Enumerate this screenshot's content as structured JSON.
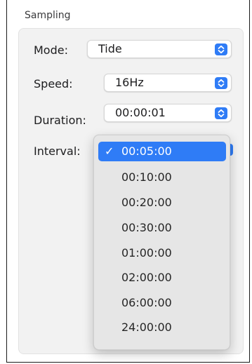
{
  "section": {
    "title": "Sampling"
  },
  "mode": {
    "label": "Mode:",
    "value": "Tide"
  },
  "speed": {
    "label": "Speed:",
    "value": "16Hz"
  },
  "duration": {
    "label": "Duration:",
    "value": "00:00:01"
  },
  "interval": {
    "label": "Interval:",
    "selected": "00:05:00",
    "options": [
      "00:05:00",
      "00:10:00",
      "00:20:00",
      "00:30:00",
      "01:00:00",
      "02:00:00",
      "06:00:00",
      "24:00:00"
    ]
  },
  "colors": {
    "accent": "#2f7cf6",
    "panel": "#f2f2f2",
    "menu": "#e6e6e6"
  },
  "icons": {
    "stepper": "up-down-chevron-icon",
    "check": "checkmark-icon"
  }
}
